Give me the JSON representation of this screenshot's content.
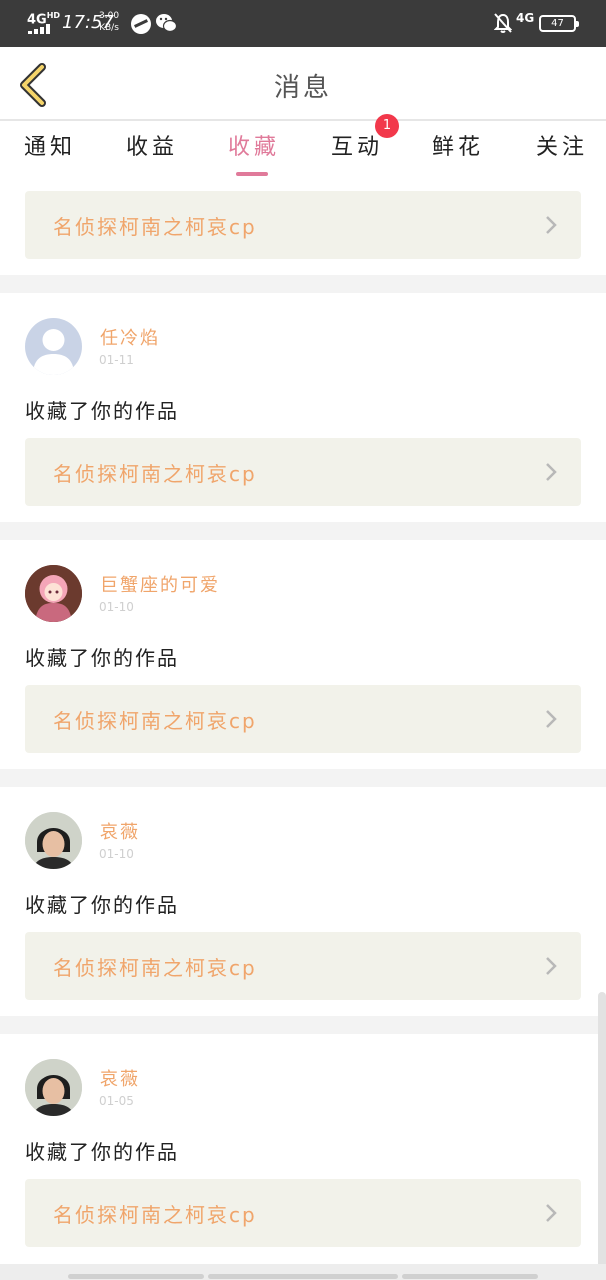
{
  "status_bar": {
    "network": "4G",
    "network_sup": "HD",
    "time": "17:57",
    "speed_value": "3.00",
    "speed_unit": "KB/s",
    "network2": "4G",
    "battery": "47",
    "icons": [
      "signal-icon",
      "app-icon",
      "wechat-icon",
      "bell-off-icon",
      "battery-icon"
    ]
  },
  "header": {
    "title": "消息",
    "back_icon": "chevron-left-icon"
  },
  "tabs": [
    {
      "label": "通知"
    },
    {
      "label": "收益"
    },
    {
      "label": "收藏",
      "active": true
    },
    {
      "label": "互动",
      "badge": "1"
    },
    {
      "label": "鲜花"
    },
    {
      "label": "关注"
    }
  ],
  "first_work": {
    "title": "名侦探柯南之柯哀cp"
  },
  "notifications": [
    {
      "user": "任冷焰",
      "time": "01-11",
      "action": "收藏了你的作品",
      "work": "名侦探柯南之柯哀cp",
      "avatar": "default-avatar-icon"
    },
    {
      "user": "巨蟹座的可爱",
      "time": "01-10",
      "action": "收藏了你的作品",
      "work": "名侦探柯南之柯哀cp",
      "avatar": "anime-avatar"
    },
    {
      "user": "哀薇",
      "time": "01-10",
      "action": "收藏了你的作品",
      "work": "名侦探柯南之柯哀cp",
      "avatar": "photo-avatar"
    },
    {
      "user": "哀薇",
      "time": "01-05",
      "action": "收藏了你的作品",
      "work": "名侦探柯南之柯哀cp",
      "avatar": "photo-avatar"
    }
  ],
  "colors": {
    "accent_pink": "#e07a9a",
    "link_orange": "#f0a56b",
    "badge_red": "#f2384b",
    "card_bg": "#f2f2ea",
    "status_bar": "#3b3b3b"
  }
}
